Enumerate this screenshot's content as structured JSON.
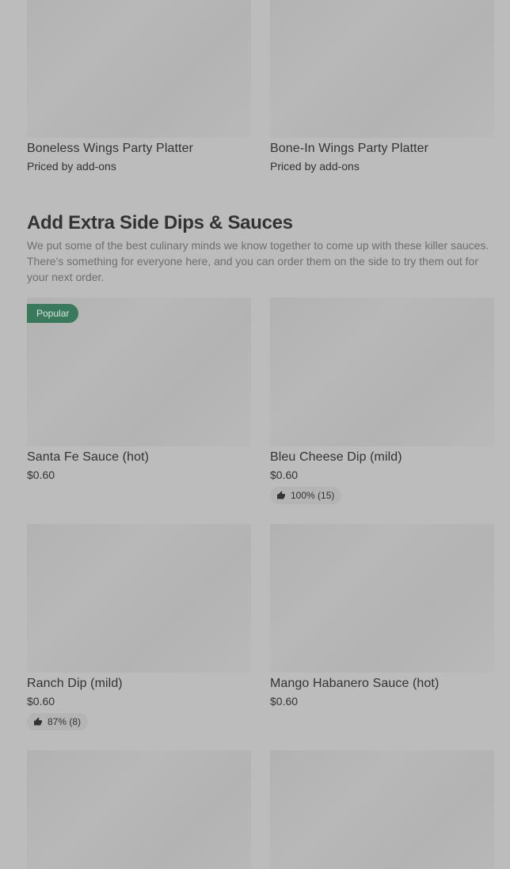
{
  "top_cards": [
    {
      "title": "Boneless Wings Party Platter",
      "price": "Priced by add-ons"
    },
    {
      "title": "Bone-In Wings Party Platter",
      "price": "Priced by add-ons"
    }
  ],
  "section": {
    "title": "Add Extra Side Dips & Sauces",
    "description": "We put some of the best culinary minds we know together to come up with these killer sauces. There's something for everyone here, and you can order them on the side to try them out for your next order."
  },
  "items": [
    {
      "title": "Santa Fe Sauce (hot)",
      "price": "$0.60",
      "badge": "Popular"
    },
    {
      "title": "Bleu Cheese Dip (mild)",
      "price": "$0.60",
      "rating": "100% (15)"
    },
    {
      "title": "Ranch Dip (mild)",
      "price": "$0.60",
      "rating": "87% (8)"
    },
    {
      "title": "Mango Habanero Sauce (hot)",
      "price": "$0.60"
    }
  ],
  "icons": {
    "thumbs_up": "thumbs-up-icon"
  },
  "colors": {
    "background": "#bcbcbc",
    "badge": "#3a7a5c"
  }
}
